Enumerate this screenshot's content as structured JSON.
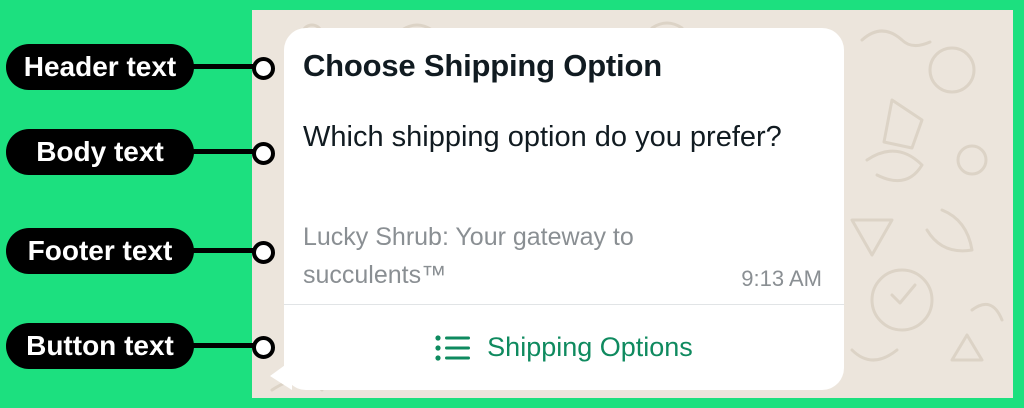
{
  "callouts": {
    "header": "Header text",
    "body": "Body text",
    "footer": "Footer text",
    "button": "Button text"
  },
  "message": {
    "header": "Choose Shipping Option",
    "body": "Which shipping option do you prefer?",
    "footer": "Lucky Shrub: Your gateway to succulents™",
    "timestamp": "9:13 AM",
    "button_label": "Shipping Options",
    "button_icon": "list-icon"
  },
  "colors": {
    "page_background": "#1ce07f",
    "chat_background": "#ece5dc",
    "bubble": "#ffffff",
    "button_text": "#0f8a5f",
    "muted_text": "#8a8f93"
  }
}
